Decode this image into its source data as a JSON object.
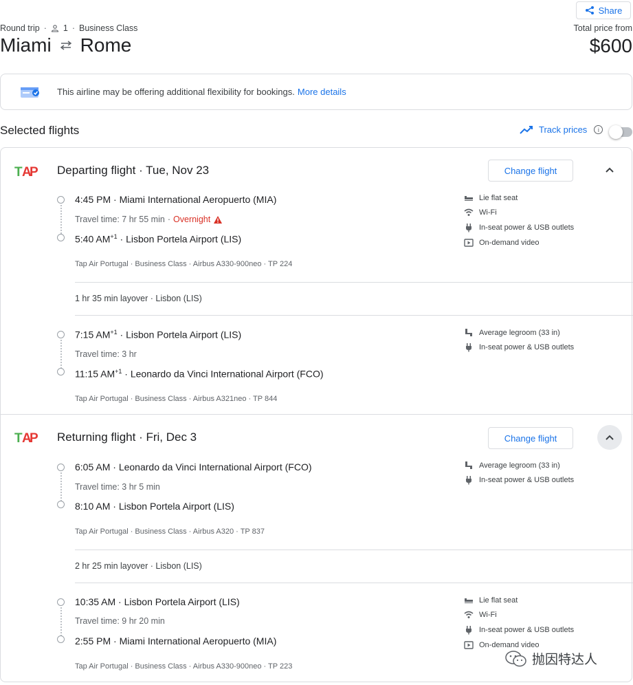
{
  "header": {
    "share_label": "Share",
    "trip_type": "Round trip",
    "passengers": "1",
    "cabin": "Business Class",
    "origin": "Miami",
    "destination": "Rome",
    "total_label": "Total price from",
    "total_price": "$600"
  },
  "notice": {
    "text": "This airline may be offering additional flexibility for bookings.",
    "link": "More details"
  },
  "selected": {
    "title": "Selected flights",
    "track_label": "Track prices",
    "track_enabled": false
  },
  "departing": {
    "title": "Departing flight",
    "date": "Tue, Nov 23",
    "change_label": "Change flight",
    "leg1": {
      "dep_time": "4:45 PM",
      "dep_airport": "Miami International Aeropuerto (MIA)",
      "travel_time": "Travel time: 7 hr 55 min",
      "overnight": "Overnight",
      "arr_time": "5:40 AM",
      "arr_sup": "+1",
      "arr_airport": "Lisbon Portela Airport (LIS)",
      "details": "Tap Air Portugal · Business Class · Airbus A330-900neo · TP 224",
      "amenities": [
        "Lie flat seat",
        "Wi-Fi",
        "In-seat power & USB outlets",
        "On-demand video"
      ]
    },
    "layover": "1 hr 35 min layover · Lisbon (LIS)",
    "leg2": {
      "dep_time": "7:15 AM",
      "dep_sup": "+1",
      "dep_airport": "Lisbon Portela Airport (LIS)",
      "travel_time": "Travel time: 3 hr",
      "arr_time": "11:15 AM",
      "arr_sup": "+1",
      "arr_airport": "Leonardo da Vinci International Airport (FCO)",
      "details": "Tap Air Portugal · Business Class · Airbus A321neo · TP 844",
      "amenities": [
        "Average legroom (33 in)",
        "In-seat power & USB outlets"
      ]
    }
  },
  "returning": {
    "title": "Returning flight",
    "date": "Fri, Dec 3",
    "change_label": "Change flight",
    "leg1": {
      "dep_time": "6:05 AM",
      "dep_airport": "Leonardo da Vinci International Airport (FCO)",
      "travel_time": "Travel time: 3 hr 5 min",
      "arr_time": "8:10 AM",
      "arr_airport": "Lisbon Portela Airport (LIS)",
      "details": "Tap Air Portugal · Business Class · Airbus A320 · TP 837",
      "amenities": [
        "Average legroom (33 in)",
        "In-seat power & USB outlets"
      ]
    },
    "layover": "2 hr 25 min layover · Lisbon (LIS)",
    "leg2": {
      "dep_time": "10:35 AM",
      "dep_airport": "Lisbon Portela Airport (LIS)",
      "travel_time": "Travel time: 9 hr 20 min",
      "arr_time": "2:55 PM",
      "arr_airport": "Miami International Aeropuerto (MIA)",
      "details": "Tap Air Portugal · Business Class · Airbus A330-900neo · TP 223",
      "amenities": [
        "Lie flat seat",
        "Wi-Fi",
        "In-seat power & USB outlets",
        "On-demand video"
      ]
    }
  },
  "watermark": "抛因特达人",
  "colors": {
    "accent": "#1a73e8",
    "warning": "#d93025",
    "tap_green": "#4caf50",
    "tap_red": "#e53935",
    "border": "#dadce0"
  }
}
